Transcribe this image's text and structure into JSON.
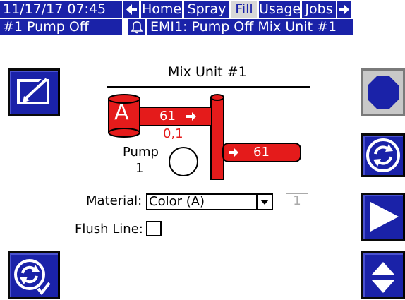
{
  "topbar": {
    "datetime": "11/17/17 07:45",
    "tabs": [
      "Home",
      "Spray",
      "Fill",
      "Usage",
      "Jobs"
    ],
    "selected_tab": "Fill"
  },
  "statusbar": {
    "pump_status": "#1 Pump Off",
    "alarm_message": "EMI1: Pump Off Mix Unit #1"
  },
  "diagram": {
    "title": "Mix Unit #1",
    "tank_label": "A",
    "inlet_flow": "61",
    "inlet_pressure": "0,1",
    "outlet_flow": "61",
    "pump_label": "Pump",
    "pump_number": "1"
  },
  "form": {
    "material_label": "Material:",
    "material_value": "Color (A)",
    "material_index": "1",
    "flush_label": "Flush Line:"
  },
  "colors": {
    "nav_blue": "#1a22a8",
    "fluid_red": "#e41b1b",
    "selected_tab_bg": "#d8d8d8"
  },
  "icons": [
    "left-arrow-icon",
    "right-arrow-icon",
    "bell-icon",
    "edit-icon",
    "stop-icon",
    "cycle-icon",
    "play-icon",
    "cycle-check-icon",
    "up-down-icon"
  ]
}
